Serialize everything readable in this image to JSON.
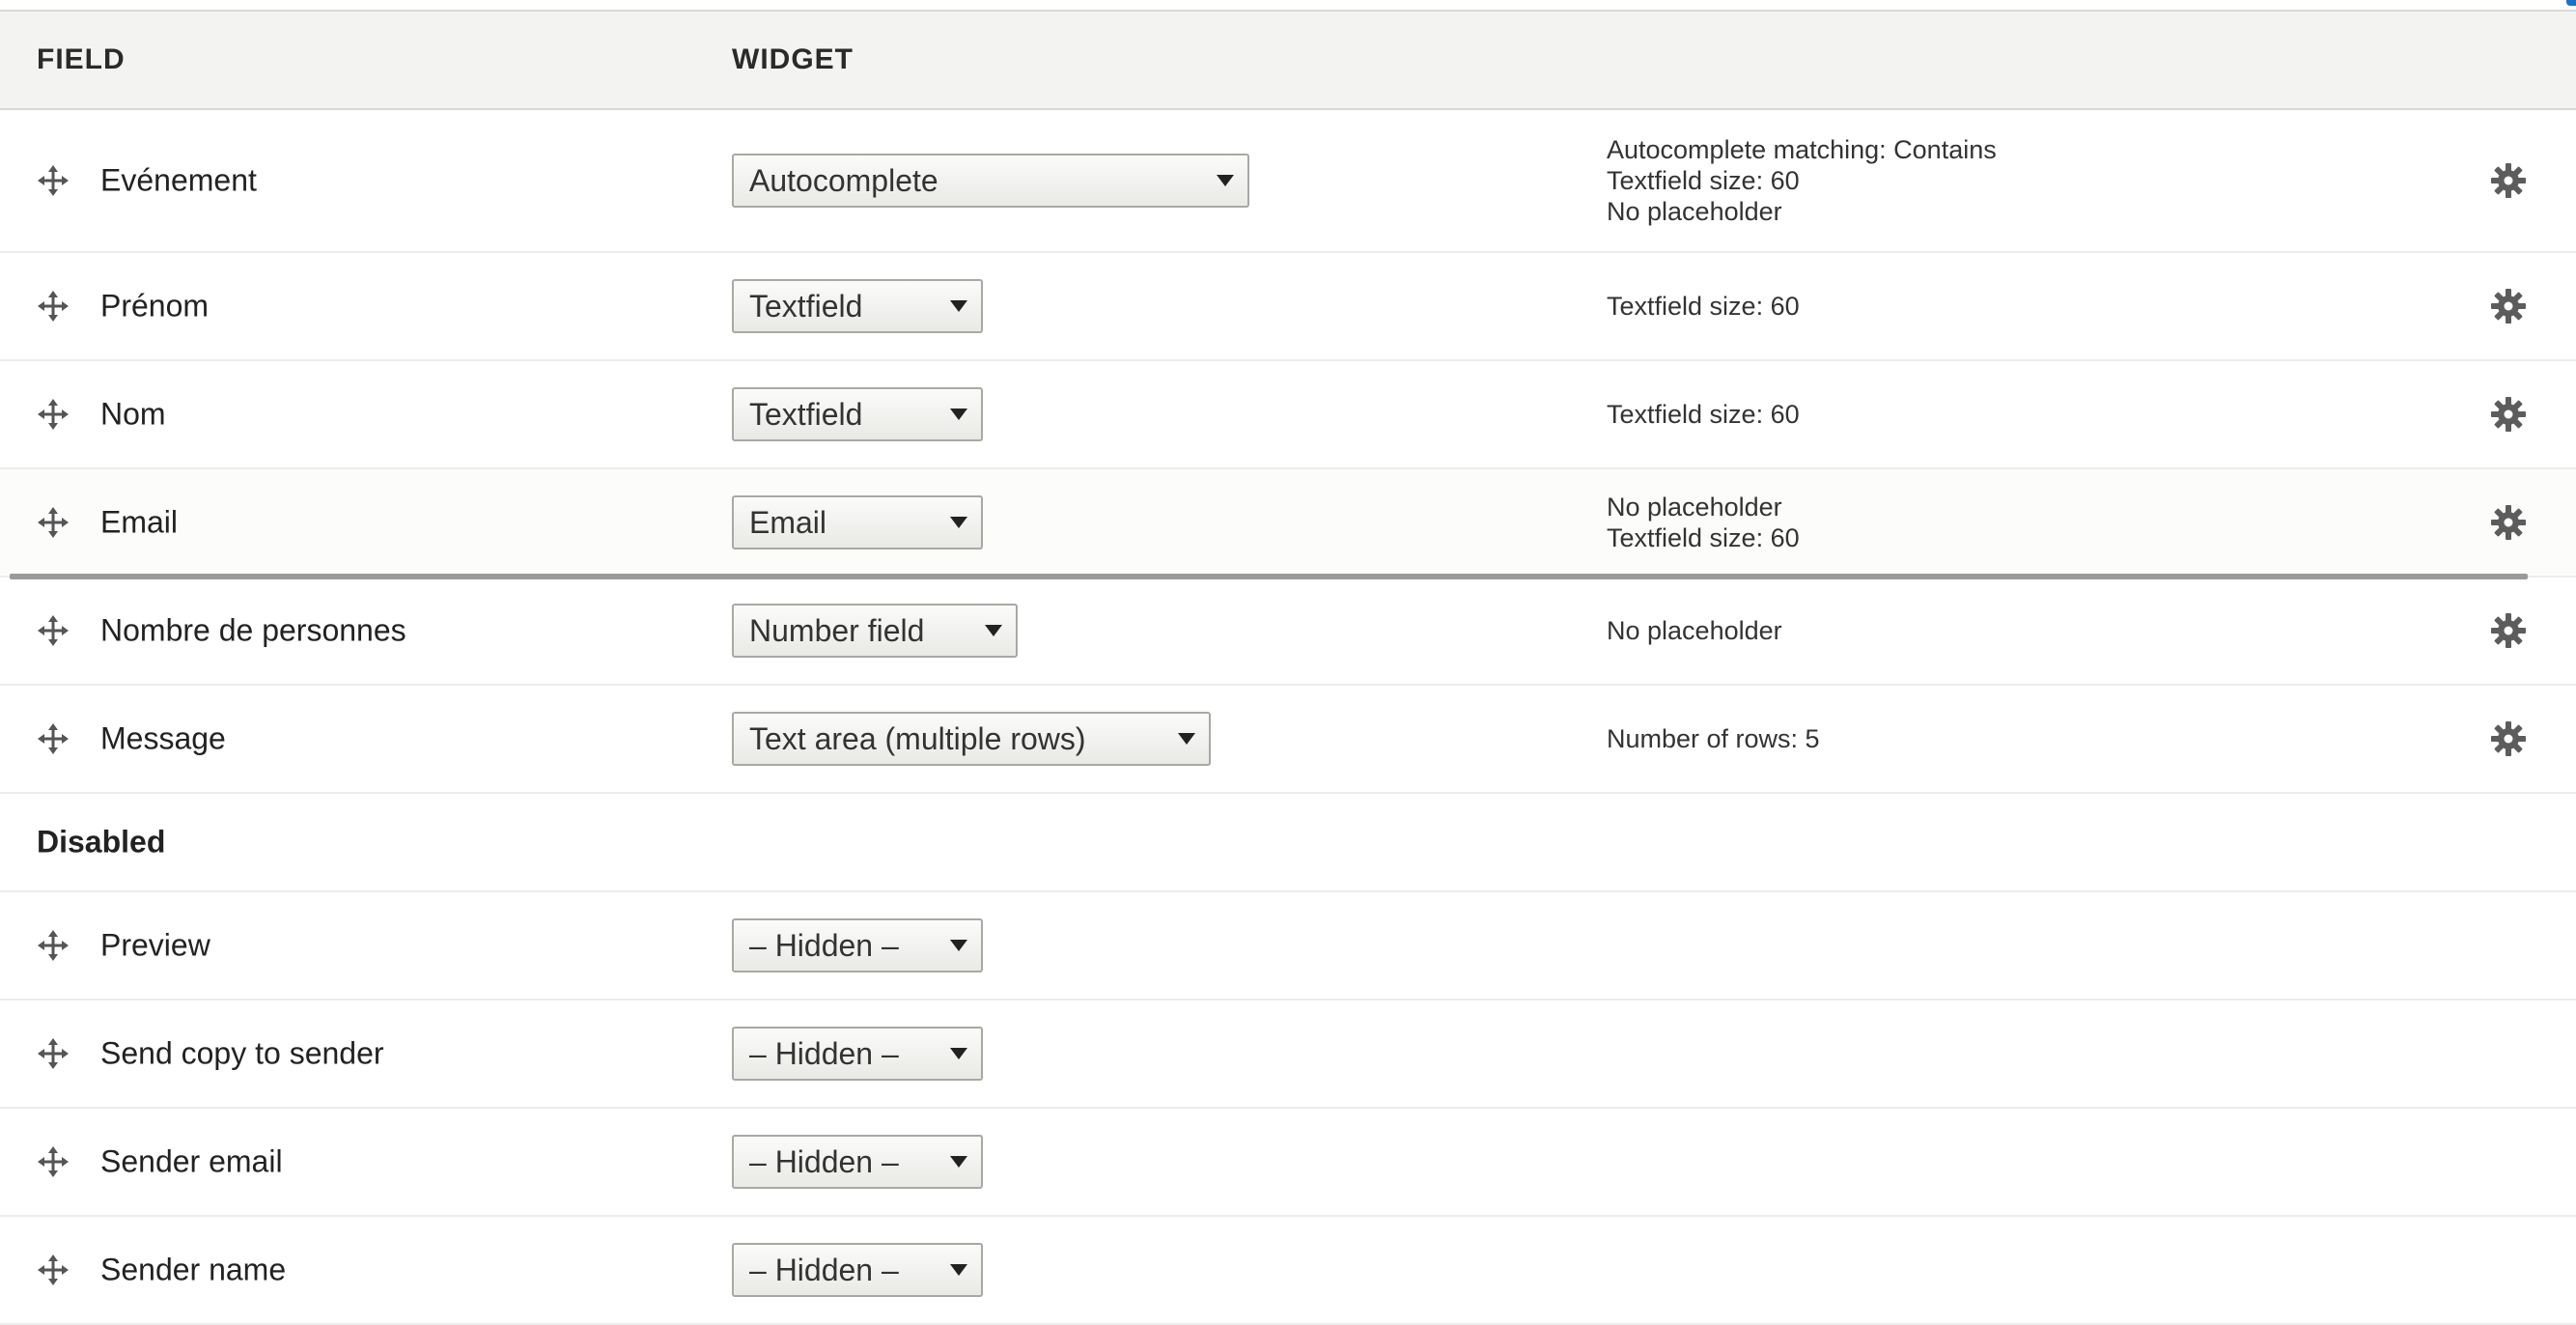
{
  "header": {
    "field_col": "FIELD",
    "widget_col": "WIDGET"
  },
  "enabled_rows": [
    {
      "label": "Evénement",
      "widget": "Autocomplete",
      "summary": [
        "Autocomplete matching: Contains",
        "Textfield size: 60",
        "No placeholder"
      ]
    },
    {
      "label": "Prénom",
      "widget": "Textfield",
      "summary": [
        "Textfield size: 60"
      ]
    },
    {
      "label": "Nom",
      "widget": "Textfield",
      "summary": [
        "Textfield size: 60"
      ]
    },
    {
      "label": "Email",
      "widget": "Email",
      "summary": [
        "No placeholder",
        "Textfield size: 60"
      ]
    },
    {
      "label": "Nombre de personnes",
      "widget": "Number field",
      "summary": [
        "No placeholder"
      ]
    },
    {
      "label": "Message",
      "widget": "Text area (multiple rows)",
      "summary": [
        "Number of rows: 5"
      ]
    }
  ],
  "disabled_region": {
    "title": "Disabled"
  },
  "disabled_rows": [
    {
      "label": "Preview",
      "widget": "– Hidden –"
    },
    {
      "label": "Send copy to sender",
      "widget": "– Hidden –"
    },
    {
      "label": "Sender email",
      "widget": "– Hidden –"
    },
    {
      "label": "Sender name",
      "widget": "– Hidden –"
    }
  ],
  "icons": {
    "drag_handle": "move-arrows-icon",
    "settings": "gear-icon"
  },
  "colors": {
    "header_bg": "#f3f3f1",
    "border": "#d9d9d6",
    "drop_indicator": "#9a9a98",
    "link_accent": "#1a73c9"
  }
}
